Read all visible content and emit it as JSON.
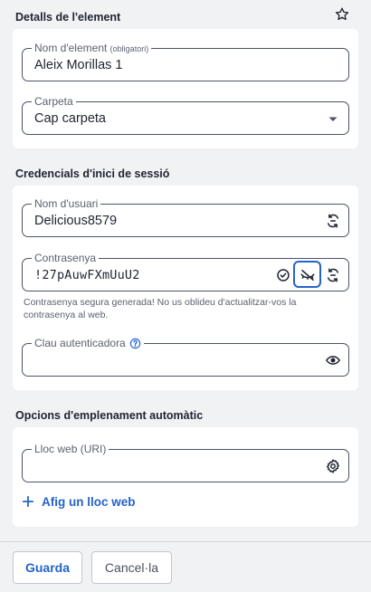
{
  "item_details": {
    "title": "Detalls de l'element",
    "name_label": "Nom d'element",
    "name_required": "(obligatori)",
    "name_value": "Aleix Morillas 1",
    "folder_label": "Carpeta",
    "folder_value": "Cap carpeta"
  },
  "credentials": {
    "title": "Credencials d'inici de sessió",
    "username_label": "Nom d'usuari",
    "username_value": "Delicious8579",
    "password_label": "Contrasenya",
    "password_value": "!27pAuwFXmUuU2",
    "password_hint": "Contrasenya segura generada! No us oblideu d'actualitzar-vos la contrasenya al web.",
    "totp_label": "Clau autenticadora",
    "totp_value": ""
  },
  "autofill": {
    "title": "Opcions d'emplenament automàtic",
    "uri_label": "Lloc web (URI)",
    "uri_value": "",
    "add_website": "Afig un lloc web"
  },
  "footer": {
    "save_label": "Guarda",
    "cancel_label": "Cancel·la"
  },
  "icons": {
    "favorite": "star-icon",
    "generate": "refresh-icon",
    "check": "check-circle-icon",
    "hide": "eye-slash-icon",
    "show": "eye-icon",
    "help": "question-circle-icon",
    "settings": "gear-icon",
    "add": "plus-icon",
    "dropdown": "caret-down-icon"
  },
  "colors": {
    "accent": "#2463c9",
    "background": "#f1f2f4",
    "card": "#ffffff",
    "text": "#1f2430"
  }
}
